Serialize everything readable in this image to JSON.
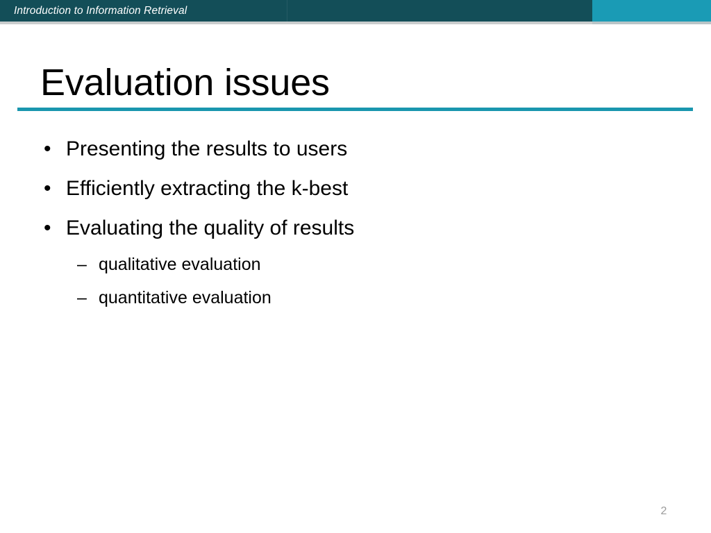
{
  "banner": {
    "course_title": "Introduction to Information Retrieval",
    "dark_color": "#134E58",
    "accent_color": "#1A9BB5"
  },
  "title": {
    "text": "Evaluation issues",
    "rule_color": "#1A96AE"
  },
  "body": {
    "bullets": [
      {
        "level": 1,
        "marker": "•",
        "text": "Presenting the results to users"
      },
      {
        "level": 1,
        "marker": "•",
        "text": "Efficiently extracting the k-best"
      },
      {
        "level": 1,
        "marker": "•",
        "text": "Evaluating the quality of results"
      },
      {
        "level": 2,
        "marker": "–",
        "text": "qualitative evaluation"
      },
      {
        "level": 2,
        "marker": "–",
        "text": "quantitative evaluation"
      }
    ]
  },
  "footer": {
    "page_number": "2",
    "page_number_color": "#9a9a9a"
  }
}
